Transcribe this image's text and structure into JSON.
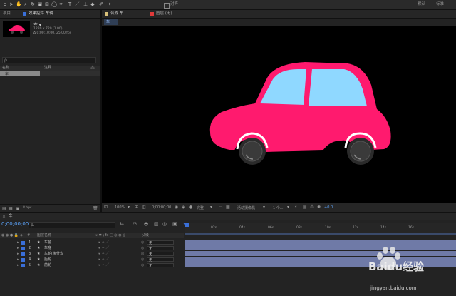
{
  "toolbar": {
    "align_label": "对齐",
    "right_labels": [
      "默认",
      "标准"
    ]
  },
  "project_panel": {
    "tab_label": "项目",
    "effects_tab_label": "效果控件 车辆",
    "item_name": "车 ▾",
    "item_info": [
      "1280 x 720 (1.00)",
      "Δ 0;00;10;00, 25.00 fps"
    ],
    "search_placeholder": "ρ",
    "col_name": "名称",
    "col_comment": "注释",
    "list_item": "车",
    "bpc": "8 bpc"
  },
  "comp_panel": {
    "tab_label": "合成 车",
    "layer_tab_label": "图层 (无)",
    "breadcrumb": "车",
    "zoom": "100%",
    "timecode": "0;00;00;00",
    "quality": "完整",
    "camera": "活动摄像机",
    "views": "1 个...",
    "exposure": "+0.0"
  },
  "timeline": {
    "comp_tab": "车",
    "timecode": "0;00;00;00",
    "search_placeholder": "ρ.",
    "col_layer_name": "图层名称",
    "col_parent": "父级",
    "ruler_labels": [
      "02s",
      "04s",
      "06s",
      "08s",
      "10s",
      "12s",
      "14s",
      "16s"
    ],
    "layers": [
      {
        "num": "1",
        "name": "车窗",
        "parent": "无"
      },
      {
        "num": "2",
        "name": "车身",
        "parent": "无"
      },
      {
        "num": "3",
        "name": "车轮(绑什么",
        "parent": "无"
      },
      {
        "num": "4",
        "name": "后轮",
        "parent": "无"
      },
      {
        "num": "5",
        "name": "前轮",
        "parent": "无"
      }
    ]
  },
  "watermark": {
    "brand": "Baidu经验",
    "url": "jingyan.baidu.com"
  },
  "colors": {
    "car_body": "#ff1a6e",
    "car_window": "#8fd8ff",
    "layer_swatch": "#3a6fd8",
    "track_bar": "#6f7aa7"
  }
}
